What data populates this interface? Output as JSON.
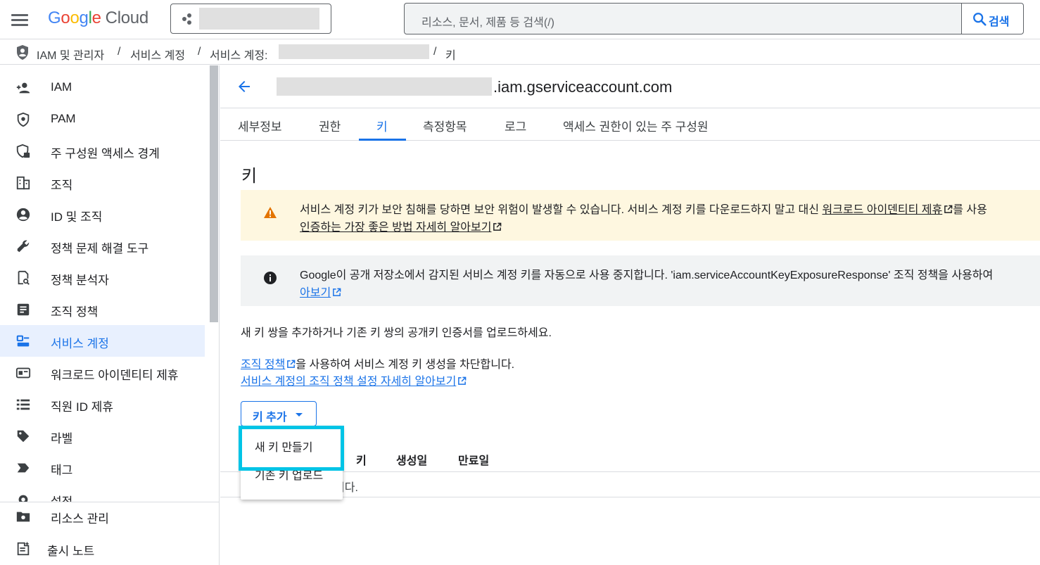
{
  "header": {
    "logo_letters": [
      "G",
      "o",
      "o",
      "g",
      "l",
      "e"
    ],
    "logo_product": "Cloud",
    "search_placeholder": "리소스, 문서, 제품 등 검색(/)",
    "search_button": "검색"
  },
  "breadcrumb": {
    "items": [
      "IAM 및 관리자",
      "서비스 계정",
      "서비스 계정: ",
      "키"
    ],
    "separator": "/"
  },
  "sidebar": {
    "items": [
      {
        "label": "IAM",
        "icon": "person-add-icon"
      },
      {
        "label": "PAM",
        "icon": "shield-icon"
      },
      {
        "label": "주 구성원 액세스 경계",
        "icon": "shield-lock-icon"
      },
      {
        "label": "조직",
        "icon": "building-icon"
      },
      {
        "label": "ID 및 조직",
        "icon": "account-circle-icon"
      },
      {
        "label": "정책 문제 해결 도구",
        "icon": "wrench-icon"
      },
      {
        "label": "정책 분석자",
        "icon": "policy-search-icon"
      },
      {
        "label": "조직 정책",
        "icon": "article-icon"
      },
      {
        "label": "서비스 계정",
        "icon": "service-account-icon"
      },
      {
        "label": "워크로드 아이덴티티 제휴",
        "icon": "id-card-icon"
      },
      {
        "label": "직원 ID 제휴",
        "icon": "list-icon"
      },
      {
        "label": "라벨",
        "icon": "label-icon"
      },
      {
        "label": "태그",
        "icon": "tag-chevron-icon"
      },
      {
        "label": "설정",
        "icon": "gear-icon"
      }
    ],
    "active_index": 8,
    "footer_items": [
      {
        "label": "리소스 관리",
        "icon": "folder-gear-icon"
      },
      {
        "label": "출시 노트",
        "icon": "release-notes-icon"
      }
    ]
  },
  "main": {
    "service_account_suffix": ".iam.gserviceaccount.com",
    "tabs": [
      "세부정보",
      "권한",
      "키",
      "측정항목",
      "로그",
      "액세스 권한이 있는 주 구성원"
    ],
    "active_tab": 2,
    "section_title": "키",
    "warning": {
      "line1_before": "서비스 계정 키가 보안 침해를 당하면 보안 위험이 발생할 수 있습니다. 서비스 계정 키를 다운로드하지 말고 대신 ",
      "line1_link": "워크로드 아이덴티티 제휴",
      "line1_after": "를 사용",
      "line2_link": "인증하는 가장 좋은 방법 자세히 알아보기"
    },
    "info": {
      "line1": "Google이 공개 저장소에서 감지된 서비스 계정 키를 자동으로 사용 중지합니다. 'iam.serviceAccountKeyExposureResponse' 조직 정책을 사용하여",
      "line2_link": "아보기"
    },
    "add_pair_text": "새 키 쌍을 추가하거나 기존 키 쌍의 공개키 인증서를 업로드하세요.",
    "org_policy_link": "조직 정책",
    "org_policy_after": "을 사용하여 서비스 계정 키 생성을 차단합니다.",
    "learn_more_link": "서비스 계정의 조직 정책 설정 자세히 알아보기",
    "add_key_button": "키 추가",
    "table_headers": [
      "키",
      "생성일",
      "만료일"
    ],
    "table_empty_suffix": "니다.",
    "dropdown_items": [
      "새 키 만들기",
      "기존 키 업로드"
    ]
  },
  "colors": {
    "accent": "#1a73e8",
    "highlight": "#00c4e6",
    "warning_bg": "#fef7e0",
    "warning_icon": "#e37400"
  }
}
